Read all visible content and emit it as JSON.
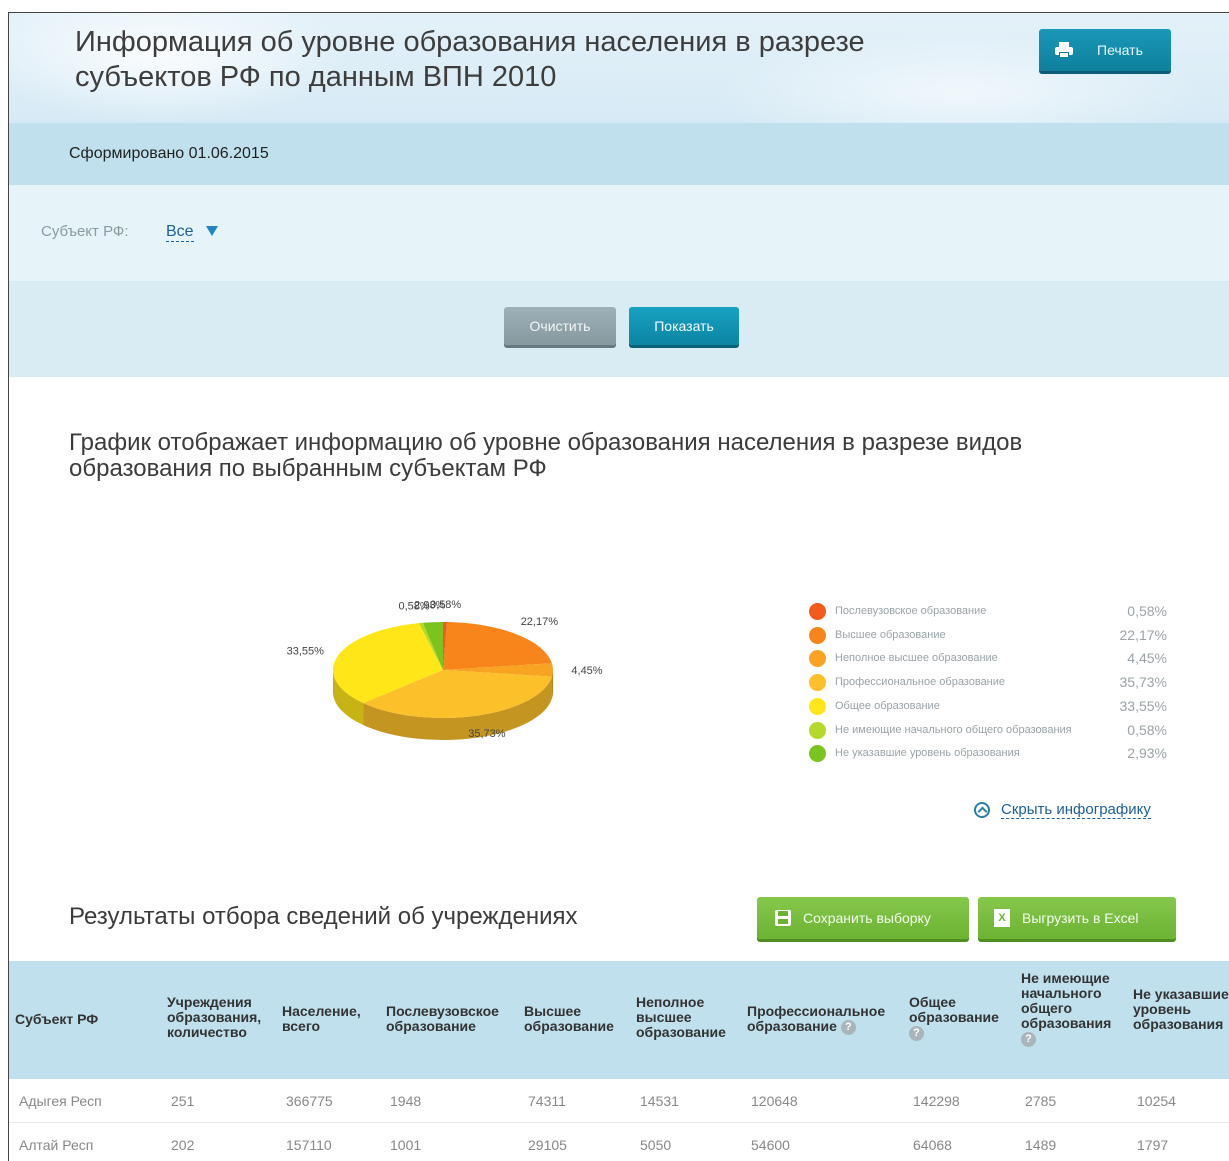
{
  "header": {
    "title": "Информация об уровне образования населения в разрезе субъектов РФ по данным ВПН 2010",
    "print_label": "Печать"
  },
  "generated": "Сформировано 01.06.2015",
  "filter": {
    "label": "Субъект РФ:",
    "value": "Все"
  },
  "actions": {
    "clear_label": "Очистить",
    "show_label": "Показать"
  },
  "chart_section": {
    "title": "График отображает информацию об уровне образования населения в разрезе видов образования по выбранным субъектам РФ",
    "hide_label": "Скрыть инфографику"
  },
  "chart_data": {
    "type": "pie",
    "categories": [
      "Послевузовское образование",
      "Высшее образование",
      "Неполное высшее образование",
      "Профессиональное образование",
      "Общее образование",
      "Не имеющие начального общего образования",
      "Не указавшие уровень образования"
    ],
    "values": [
      0.58,
      22.17,
      4.45,
      35.73,
      33.55,
      0.58,
      2.93
    ],
    "labels": [
      "0,58%",
      "22,17%",
      "4,45%",
      "35,73%",
      "33,55%",
      "0,58%",
      "2,93%"
    ],
    "colors": [
      "#f25a1e",
      "#f7851c",
      "#f9a323",
      "#fbc02a",
      "#ffe619",
      "#b5d92a",
      "#7bc31e"
    ],
    "legend": "right"
  },
  "results": {
    "title": "Результаты отбора сведений об учреждениях",
    "save_label": "Сохранить выборку",
    "excel_label": "Выгрузить в Excel",
    "excel_icon": "X"
  },
  "table": {
    "headers": [
      "Субъект РФ",
      "Учреждения образования, количество",
      "Население, всего",
      "Послевузовское образование",
      "Высшее образование",
      "Неполное высшее образование",
      "Профессиональное образование",
      "Общее образование",
      "Не имеющие начального общего образования",
      "Не указавшие уровень образования"
    ],
    "rows": [
      [
        "Адыгея Респ",
        "251",
        "366775",
        "1948",
        "74311",
        "14531",
        "120648",
        "142298",
        "2785",
        "10254"
      ],
      [
        "Алтай Респ",
        "202",
        "157110",
        "1001",
        "29105",
        "5050",
        "54600",
        "64068",
        "1489",
        "1797"
      ]
    ]
  },
  "icons": {
    "print": "printer-icon",
    "caret": "caret-down-icon",
    "hide": "collapse-icon",
    "save": "floppy-disk-icon",
    "excel": "excel-icon",
    "help": "question-icon"
  },
  "help_glyph": "?"
}
